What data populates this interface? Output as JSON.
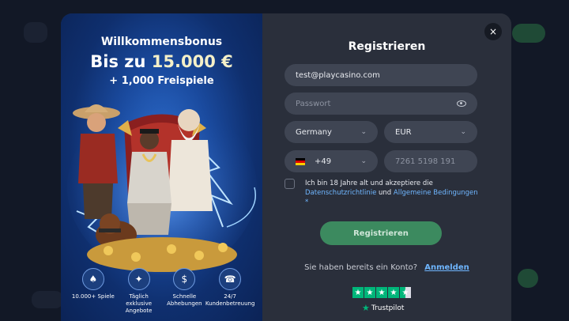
{
  "promo": {
    "title": "Willkommensbonus",
    "amount_prefix": "Bis zu",
    "amount_value": "15.000 €",
    "spins": "+ 1,000 Freispiele",
    "features": [
      {
        "icon": "cards-icon",
        "label": "10.000+ Spiele"
      },
      {
        "icon": "gift-icon",
        "label": "Täglich exklusive Angebote"
      },
      {
        "icon": "money-bag-icon",
        "label": "Schnelle Abhebungen"
      },
      {
        "icon": "phone-support-icon",
        "label": "24/7 Kundenbetreuung"
      }
    ]
  },
  "form": {
    "close_symbol": "×",
    "title": "Registrieren",
    "email_value": "test@playcasino.com",
    "password_placeholder": "Passwort",
    "country_value": "Germany",
    "currency_value": "EUR",
    "phone_code": "+49",
    "phone_placeholder": "7261 5198 191",
    "terms_prefix": "Ich bin 18 Jahre alt und akzeptiere die",
    "privacy_link": "Datenschutzrichtlinie",
    "terms_and": "und",
    "conditions_link": "Allgemeine Bedingungen",
    "terms_asterisk": "*",
    "submit_label": "Registrieren",
    "login_question": "Sie haben bereits ein Konto?",
    "login_link": "Anmelden",
    "trustpilot_label": "Trustpilot",
    "trustpilot_rating": 4.5
  },
  "colors": {
    "accent_green": "#3c8a5f",
    "link_blue": "#6fb6ff",
    "trustpilot_green": "#00b67a"
  }
}
